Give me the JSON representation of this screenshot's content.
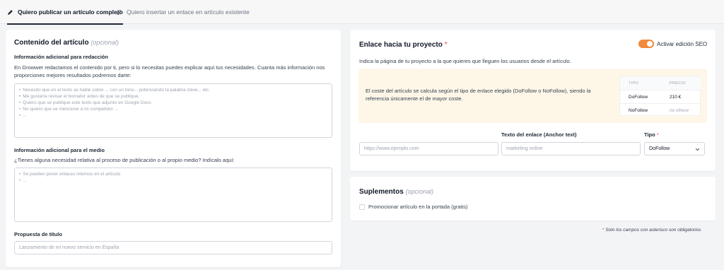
{
  "tabs": [
    {
      "label": "Quiero publicar un artículo completo",
      "icon": "pencil-icon"
    },
    {
      "label": "Quiero insertar un enlace en artículo existente",
      "icon": "link-icon"
    }
  ],
  "content": {
    "title": "Contenido del artículo",
    "optional": "(opcional)",
    "redaccion": {
      "label": "Información adicional para redacción",
      "text": "En Growwer redactamos el contenido por ti, pero si lo necesitas puedes explicar aquí tus necesidades. Cuanta más información nos proporciones mejores resultados podremos darte:",
      "placeholder": [
        "Necesito que en el texto se hable sobre ... con un tono... potenciando la palabra clave... etc.",
        "Me gustaría revisar el borrador antes de que se publique.",
        "Quiero que se publique este texto que adjunto en Google Docs",
        "No quiero que se mencione a mi competidor ...",
        "..."
      ]
    },
    "medio": {
      "label": "Información adicional para el medio",
      "text": "¿Tienes alguna necesidad relativa al proceso de publicación o al propio medio? Indícalo aquí:",
      "placeholder": [
        "Se pueden poner enlaces internos en el artículo",
        "..."
      ]
    },
    "titulo": {
      "label": "Propuesta de título",
      "placeholder": "Lanzamiento de mi nuevo servicio en España"
    }
  },
  "link": {
    "title": "Enlace hacia tu proyecto",
    "required_mark": "*",
    "seo_toggle_label": "Activar edición SEO",
    "seo_toggle_on": true,
    "description": "Indica la página de tu proyecto a la que quieres que lleguen los usuarios desde el artículo.",
    "note": "El coste del artículo se calcula según el tipo de enlace elegido (DoFollow o NoFollow), siendo la referencia únicamente el de mayor coste.",
    "price_table": {
      "headers": [
        "TIPO",
        "PRECIO"
      ],
      "rows": [
        [
          "DoFollow",
          "210 €"
        ],
        [
          "NoFollow",
          "no ofrece"
        ]
      ]
    },
    "anchor_label": "Texto del enlace (Anchor text)",
    "type_label": "Tipo",
    "url_placeholder": "https://www.ejemplo.com",
    "anchor_placeholder": "marketing online",
    "type_value": "DoFollow",
    "accent": "#f08a3c"
  },
  "supplements": {
    "title": "Suplementos",
    "optional": "(opcional)",
    "checkbox_label": "Promocionar artículo en la portada (gratis)"
  },
  "footnote": {
    "mark": "*",
    "text": "Solo los campos con asterisco son obligatorios"
  }
}
